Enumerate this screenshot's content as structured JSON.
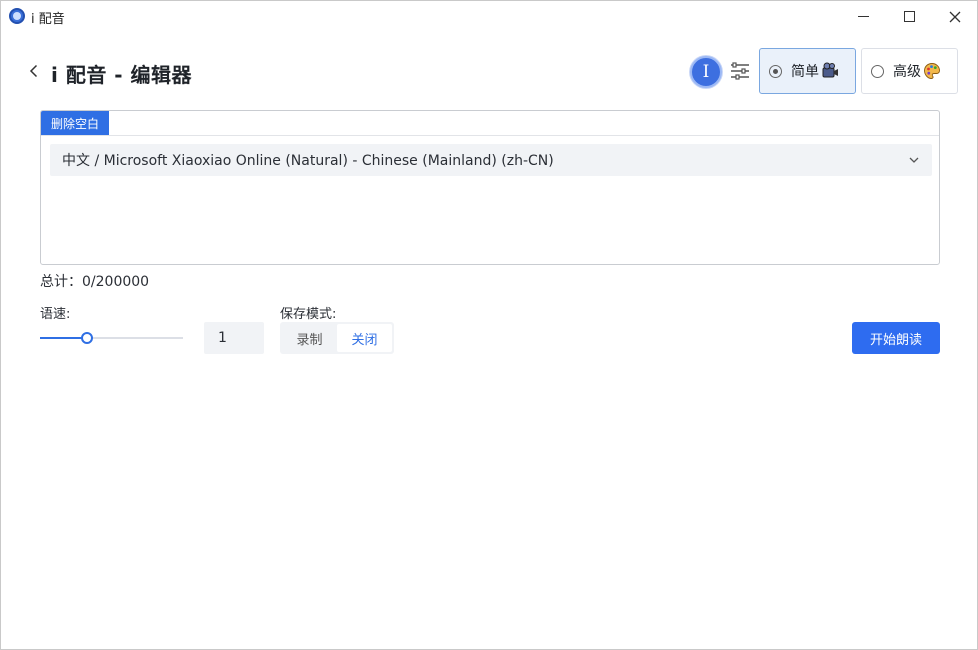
{
  "window": {
    "title": "i 配音",
    "controls": [
      "minimize-icon",
      "maximize-icon",
      "close-icon"
    ]
  },
  "header": {
    "title": "i 配音 - 编辑器",
    "info_icon_glyph": "I",
    "modes": [
      {
        "label": "简单",
        "selected": true,
        "emoji": "film-projector-icon"
      },
      {
        "label": "高级",
        "selected": false,
        "emoji": "palette-icon"
      }
    ]
  },
  "editor": {
    "tab_label": "删除空白",
    "voice_select_value": "中文 / Microsoft Xiaoxiao Online (Natural) - Chinese (Mainland) (zh-CN)",
    "text_value": ""
  },
  "total": {
    "text": "总计：0/200000"
  },
  "controls": {
    "speed_label": "语速:",
    "speed_value": "1",
    "speed_fraction": 0.33,
    "save_mode_label": "保存模式:",
    "save_mode_options": [
      "录制",
      "关闭"
    ],
    "save_mode_selected": "关闭",
    "start_button_label": "开始朗读"
  },
  "colors": {
    "accent": "#2e6cf0",
    "selected_card_bg": "#eaf1fa",
    "selected_card_border": "#7aa7e0",
    "input_bg": "#f1f3f6"
  }
}
